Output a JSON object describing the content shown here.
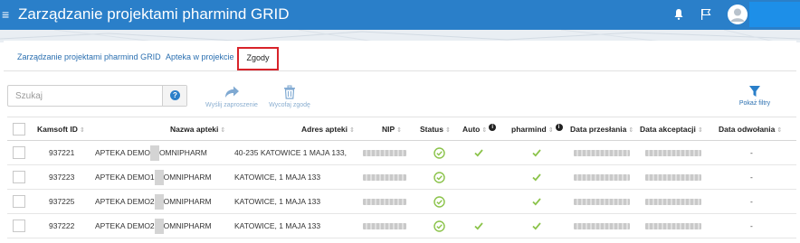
{
  "app": {
    "title": "Zarządzanie projektami pharmind GRID"
  },
  "tabs": [
    {
      "label": "Zarządzanie projektami pharmind GRID"
    },
    {
      "label": "Apteka w projekcie"
    },
    {
      "label": "Zgody"
    }
  ],
  "toolbar": {
    "search_placeholder": "Szukaj",
    "send_label": "Wyślij zaproszenie",
    "revoke_label": "Wycofaj zgodę",
    "filters_label": "Pokaż filtry"
  },
  "table": {
    "headers": {
      "kamsoft_id": "Kamsoft ID",
      "name": "Nazwa apteki",
      "address": "Adres apteki",
      "nip": "NIP",
      "status": "Status",
      "auto": "Auto",
      "pharmind": "pharmind",
      "sent": "Data przesłania",
      "accepted": "Data akceptacji",
      "revoked": "Data odwołania"
    },
    "rows": [
      {
        "id": "937221",
        "name_left": "APTEKA DEMO",
        "name_right": "OMNIPHARM",
        "address": "40-235 KATOWICE 1 MAJA 133,",
        "auto": true,
        "revoked": "-"
      },
      {
        "id": "937223",
        "name_left": "APTEKA DEMO1",
        "name_right": "OMNIPHARM",
        "address": "KATOWICE, 1 MAJA 133",
        "auto": false,
        "revoked": "-"
      },
      {
        "id": "937225",
        "name_left": "APTEKA DEMO2",
        "name_right": "OMNIPHARM",
        "address": "KATOWICE, 1 MAJA 133",
        "auto": false,
        "revoked": "-"
      },
      {
        "id": "937222",
        "name_left": "APTEKA DEMO2",
        "name_right": "OMNIPHARM",
        "address": "KATOWICE, 1 MAJA 133",
        "auto": true,
        "revoked": "-"
      }
    ]
  },
  "colors": {
    "primary": "#2a7fc9",
    "highlight": "#d8232a",
    "ok": "#8bc34a"
  },
  "icons": [
    "menu-icon",
    "bell-icon",
    "flag-icon",
    "avatar-icon",
    "info-icon",
    "send-icon",
    "trash-icon",
    "filter-icon",
    "check-circle-icon",
    "check-icon"
  ]
}
